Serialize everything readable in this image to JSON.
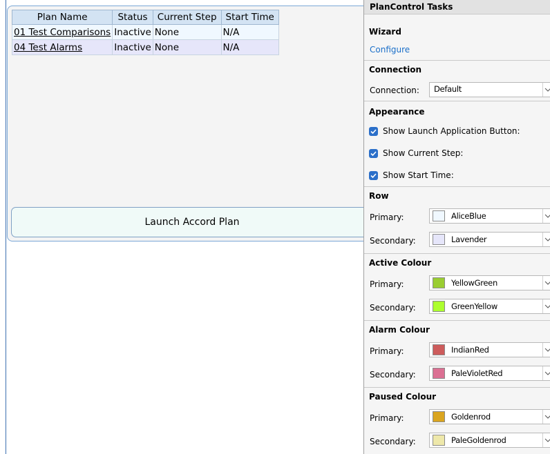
{
  "grid": {
    "columns": [
      "Plan Name",
      "Status",
      "Current Step",
      "Start Time"
    ],
    "rows": [
      {
        "name": "01 Test Comparisons",
        "status": "Inactive",
        "step": "None",
        "start": "N/A"
      },
      {
        "name": "04 Test Alarms",
        "status": "Inactive",
        "step": "None",
        "start": "N/A"
      }
    ]
  },
  "launch_button": "Launch Accord Plan",
  "panel": {
    "title": "PlanControl Tasks",
    "wizard": {
      "header": "Wizard",
      "configure": "Configure"
    },
    "connection": {
      "header": "Connection",
      "label": "Connection:",
      "value": "Default"
    },
    "appearance": {
      "header": "Appearance",
      "show_launch": "Show Launch Application Button:",
      "show_step": "Show Current Step:",
      "show_start": "Show Start Time:"
    },
    "row": {
      "header": "Row",
      "primary_label": "Primary:",
      "primary": "AliceBlue",
      "primary_color": "#F0F8FF",
      "secondary_label": "Secondary:",
      "secondary": "Lavender",
      "secondary_color": "#E6E6FA"
    },
    "active": {
      "header": "Active Colour",
      "primary_label": "Primary:",
      "primary": "YellowGreen",
      "primary_color": "#9ACD32",
      "secondary_label": "Secondary:",
      "secondary": "GreenYellow",
      "secondary_color": "#ADFF2F"
    },
    "alarm": {
      "header": "Alarm Colour",
      "primary_label": "Primary:",
      "primary": "IndianRed",
      "primary_color": "#CD5C5C",
      "secondary_label": "Secondary:",
      "secondary": "PaleVioletRed",
      "secondary_color": "#DB7093"
    },
    "paused": {
      "header": "Paused Colour",
      "primary_label": "Primary:",
      "primary": "Goldenrod",
      "primary_color": "#DAA520",
      "secondary_label": "Secondary:",
      "secondary": "PaleGoldenrod",
      "secondary_color": "#EEE8AA"
    }
  }
}
